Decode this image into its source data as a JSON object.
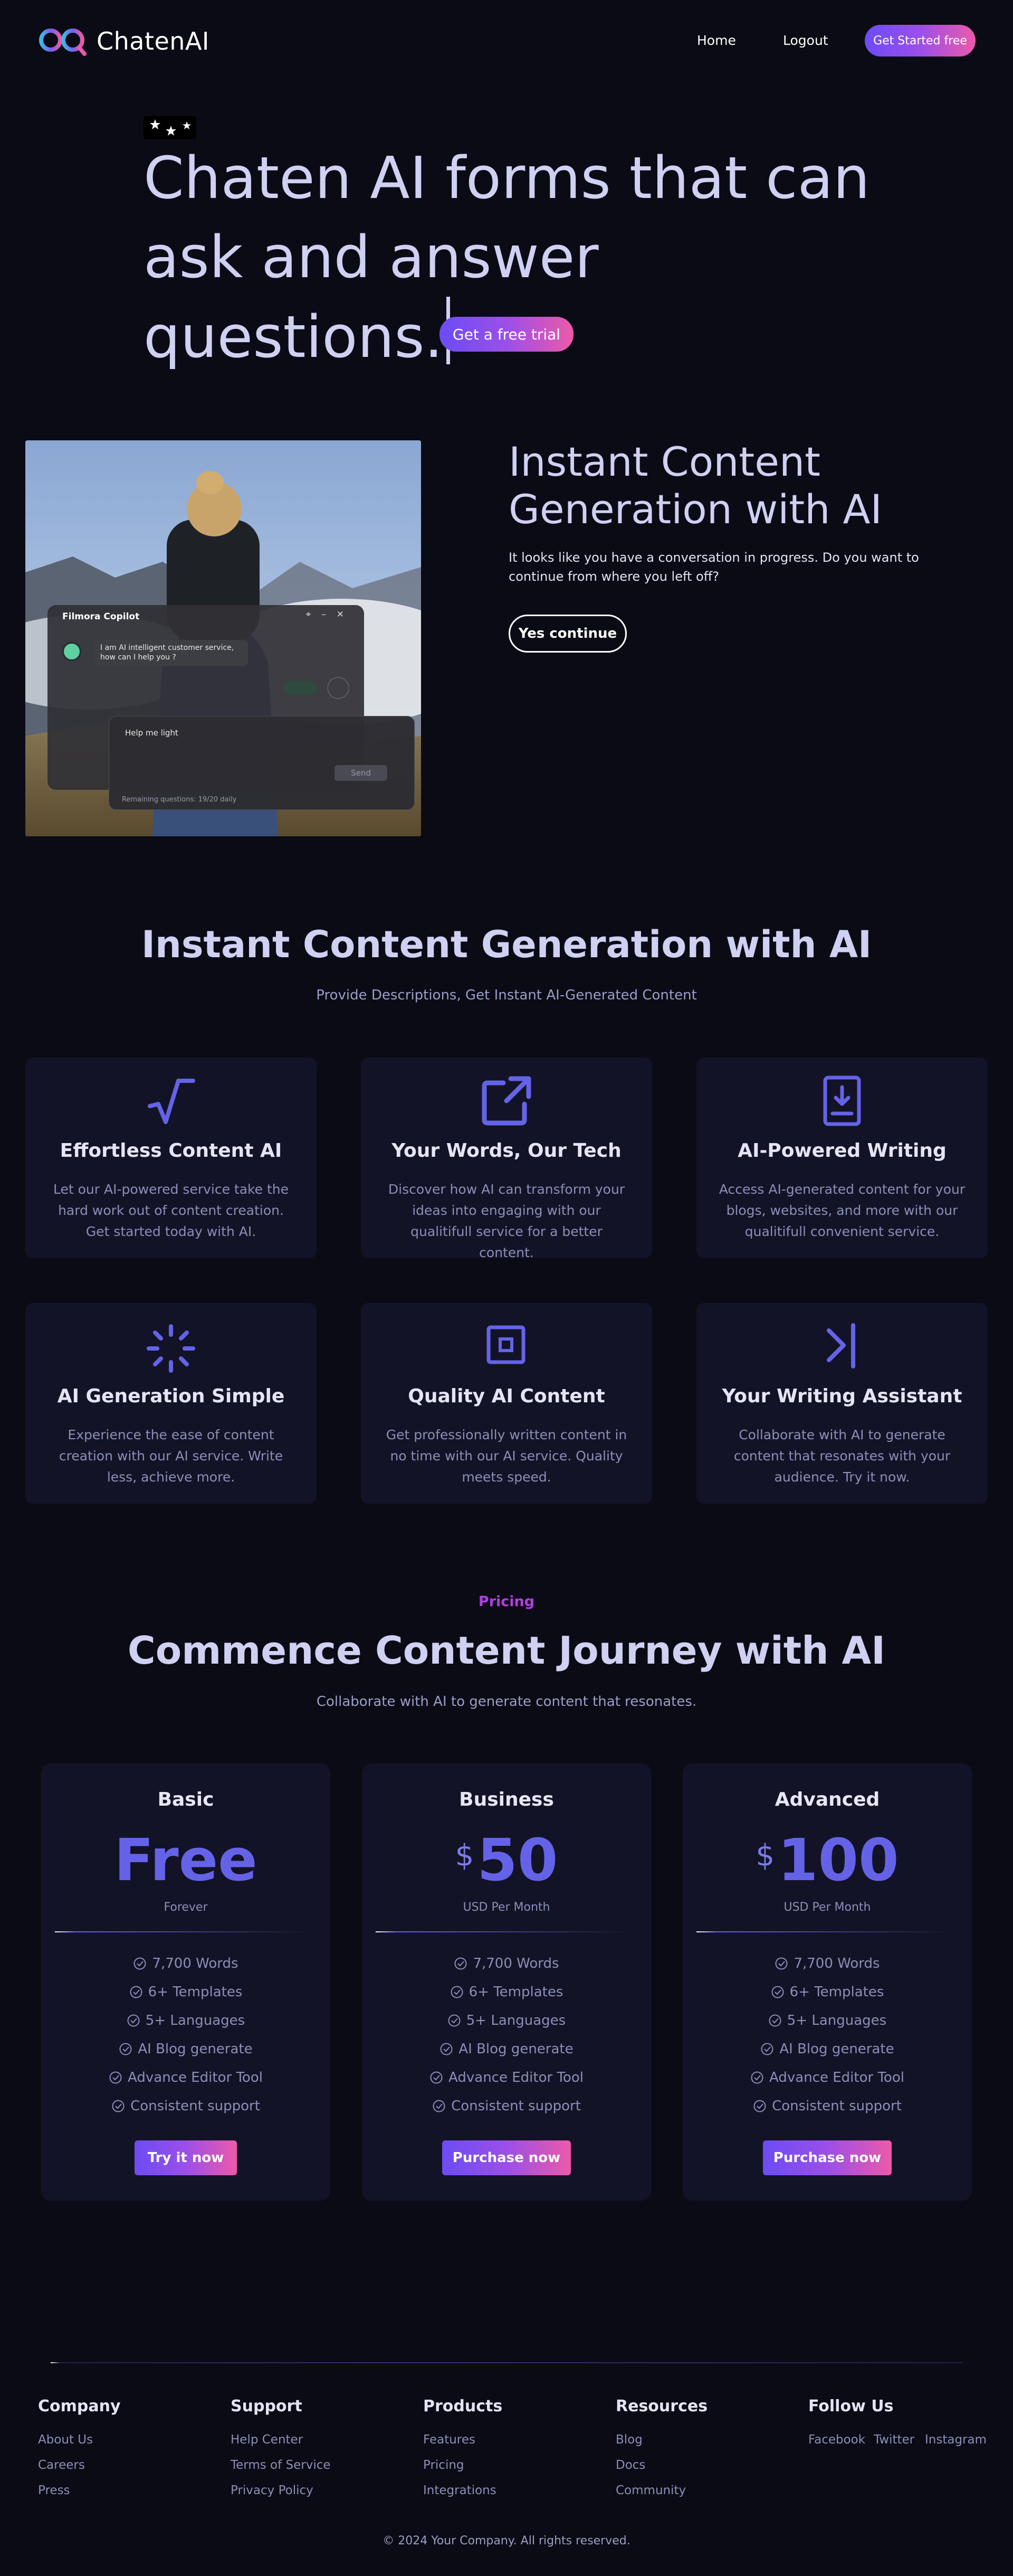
{
  "header": {
    "brand": "ChatenAI",
    "nav": {
      "home": "Home",
      "logout": "Logout"
    },
    "cta": "Get Started free"
  },
  "hero": {
    "line1": "Chaten AI forms that can",
    "line2": "ask and answer questions.",
    "cta": "Get a free trial"
  },
  "demo": {
    "copilot_title": "Filmora Copilot",
    "copilot_message": "I am AI intelligent customer service, how can I help you ?",
    "input_text": "Help me light",
    "send_label": "Send",
    "remaining": "Remaining questions: 19/20 daily"
  },
  "continue": {
    "title": "Instant Content Generation with AI",
    "text": "It looks like you have a conversation in progress. Do you want to continue from where you left off?",
    "button": "Yes continue"
  },
  "features": {
    "title": "Instant Content Generation with AI",
    "subtitle": "Provide Descriptions, Get Instant AI-Generated Content",
    "cards": [
      {
        "icon": "square-root-icon",
        "title": "Effortless Content AI",
        "desc": "Let our AI-powered service take the hard work out of content creation. Get started today with AI."
      },
      {
        "icon": "external-link-icon",
        "title": "Your Words, Our Tech",
        "desc": "Discover how AI can transform your ideas into engaging with our qualitifull service for a better content."
      },
      {
        "icon": "book-download-icon",
        "title": "AI-Powered Writing",
        "desc": "Access AI-generated content for your blogs, websites, and more with our qualitifull convenient service."
      },
      {
        "icon": "loader-icon",
        "title": "AI Generation Simple",
        "desc": "Experience the ease of content creation with our AI service. Write less, achieve more."
      },
      {
        "icon": "square-dot-icon",
        "title": "Quality AI Content",
        "desc": "Get professionally written content in no time with our AI service. Quality meets speed."
      },
      {
        "icon": "chevron-bar-right-icon",
        "title": "Your Writing Assistant",
        "desc": "Collaborate with AI to generate content that resonates with your audience. Try it now."
      }
    ]
  },
  "pricing": {
    "label": "Pricing",
    "title": "Commence Content Journey with AI",
    "subtitle": "Collaborate with AI to generate content that resonates.",
    "plans": [
      {
        "name": "Basic",
        "currency": "",
        "price": "Free",
        "period": "Forever",
        "button": "Try it now",
        "features": [
          "7,700 Words",
          "6+ Templates",
          "5+ Languages",
          "AI Blog generate",
          "Advance Editor Tool",
          "Consistent support"
        ]
      },
      {
        "name": "Business",
        "currency": "$",
        "price": "50",
        "period": "USD Per Month",
        "button": "Purchase now",
        "features": [
          "7,700 Words",
          "6+ Templates",
          "5+ Languages",
          "AI Blog generate",
          "Advance Editor Tool",
          "Consistent support"
        ]
      },
      {
        "name": "Advanced",
        "currency": "$",
        "price": "100",
        "period": "USD Per Month",
        "button": "Purchase now",
        "features": [
          "7,700 Words",
          "6+ Templates",
          "5+ Languages",
          "AI Blog generate",
          "Advance Editor Tool",
          "Consistent support"
        ]
      }
    ]
  },
  "footer": {
    "columns": [
      {
        "title": "Company",
        "links": [
          "About Us",
          "Careers",
          "Press"
        ]
      },
      {
        "title": "Support",
        "links": [
          "Help Center",
          "Terms of Service",
          "Privacy Policy"
        ]
      },
      {
        "title": "Products",
        "links": [
          "Features",
          "Pricing",
          "Integrations"
        ]
      },
      {
        "title": "Resources",
        "links": [
          "Blog",
          "Docs",
          "Community"
        ]
      }
    ],
    "follow": {
      "title": "Follow Us",
      "links": [
        "Facebook",
        "Twitter",
        "Instagram"
      ]
    },
    "copyright": "© 2024 Your Company. All rights reserved."
  },
  "colors": {
    "background": "#0b0b15",
    "card": "#131327",
    "accent": "#6463e8",
    "pink": "#ec5aa9",
    "pricing_label": "#b23ee0"
  }
}
